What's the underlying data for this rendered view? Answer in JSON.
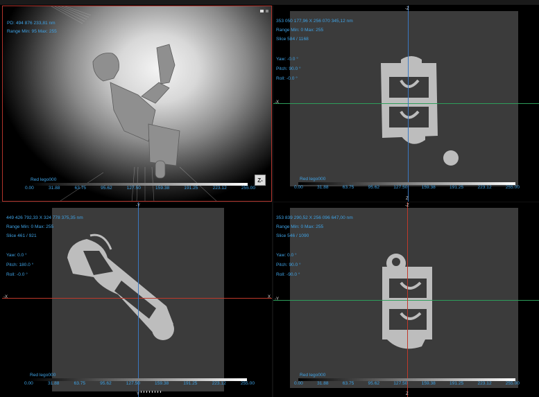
{
  "viewports": {
    "tl": {
      "pd": "PD: 494 876 233,81 nm",
      "range": "Range Min: 95 Max: 255",
      "zbutton": "Z-",
      "dataset": "Red lego000"
    },
    "tr": {
      "size": "353 050 177,96 X 256 070 345,12 nm",
      "range": "Range Min: 0 Max: 255",
      "slice": "Slice 584 / 1168",
      "yaw": "Yaw: -0.0 °",
      "pitch": "Pitch: 90.0 °",
      "roll": "Roll: -0.0 °",
      "axis_top": "-Z",
      "axis_left": "-X",
      "axis_bottom": "Z",
      "dataset": "Red lego000"
    },
    "bl": {
      "size": "449 426 792,33 X 324 778 375,35 nm",
      "range": "Range Min: 0 Max: 255",
      "slice": "Slice 461 / 921",
      "yaw": "Yaw: 0.0 °",
      "pitch": "Pitch: 180.0 °",
      "roll": "Roll: -0.0 °",
      "axis_top": "-Y",
      "axis_left": "-X",
      "axis_right": "X",
      "axis_bottom": "Y",
      "dataset": "Red lego000"
    },
    "br": {
      "size": "353 839 290,52 X 256 096 647,00 nm",
      "range": "Range Min: 0 Max: 255",
      "slice": "Slice 546 / 1090",
      "yaw": "Yaw: 0.0 °",
      "pitch": "Pitch: 90.0 °",
      "roll": "Roll: -90.0 °",
      "axis_top": "-Z",
      "axis_left": "-Y",
      "axis_right": "Y",
      "axis_bottom": "Z",
      "dataset": "Red lego000"
    }
  },
  "colorbar_ticks": [
    "0.00",
    "31.88",
    "63.75",
    "95.62",
    "127.50",
    "159.38",
    "191.25",
    "223.12",
    "255.00"
  ],
  "colors": {
    "blue_text": "#3fa3e6",
    "red_line": "#c0392b",
    "green_line": "#2e9e5b",
    "blue_line": "#3a78c2"
  },
  "icons": [
    "camera-icon",
    "layout-icon"
  ]
}
